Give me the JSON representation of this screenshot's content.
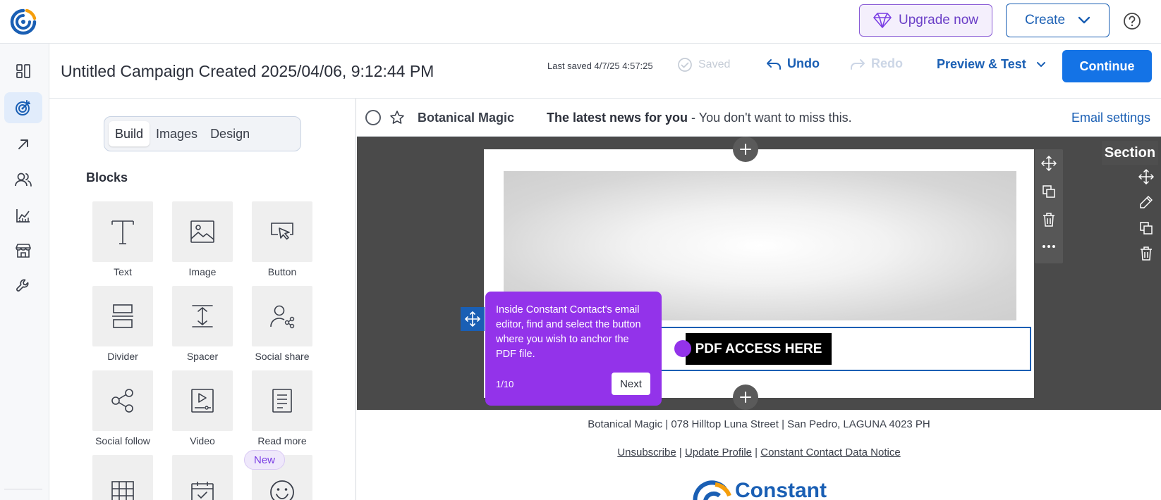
{
  "topbar": {
    "upgrade_label": "Upgrade now",
    "create_label": "Create"
  },
  "nav": {
    "items": [
      "dashboard-icon",
      "campaigns-icon",
      "outreach-icon",
      "contacts-icon",
      "reporting-icon",
      "store-icon",
      "tools-icon"
    ],
    "active": "campaigns-icon"
  },
  "header": {
    "campaign_title": "Untitled Campaign Created 2025/04/06, 9:12:44 PM",
    "last_saved": "Last saved 4/7/25 4:57:25",
    "saved_label": "Saved",
    "undo_label": "Undo",
    "redo_label": "Redo",
    "preview_label": "Preview & Test",
    "continue_label": "Continue"
  },
  "panel": {
    "tabs": [
      {
        "label": "Build",
        "active": true
      },
      {
        "label": "Images",
        "active": false
      },
      {
        "label": "Design",
        "active": false
      }
    ],
    "blocks_heading": "Blocks",
    "blocks": [
      {
        "label": "Text",
        "icon": "text-icon"
      },
      {
        "label": "Image",
        "icon": "image-icon"
      },
      {
        "label": "Button",
        "icon": "button-icon"
      },
      {
        "label": "Divider",
        "icon": "divider-icon"
      },
      {
        "label": "Spacer",
        "icon": "spacer-icon"
      },
      {
        "label": "Social share",
        "icon": "social-share-icon"
      },
      {
        "label": "Social follow",
        "icon": "social-follow-icon"
      },
      {
        "label": "Video",
        "icon": "video-icon"
      },
      {
        "label": "Read more",
        "icon": "read-more-icon"
      }
    ],
    "new_badge": "New"
  },
  "subject": {
    "sender": "Botanical Magic",
    "subject_bold": "The latest news for you",
    "subject_rest": " - You don't want to miss this.",
    "settings_label": "Email settings"
  },
  "canvas": {
    "pdf_button_label": "PDF ACCESS HERE",
    "section_label": "Section"
  },
  "tooltip": {
    "text": "Inside Constant Contact's email editor, find and select the button where you wish to anchor the PDF file.",
    "step": "1/10",
    "next_label": "Next"
  },
  "footer": {
    "address": "Botanical Magic | 078 Hilltop Luna Street | San Pedro, LAGUNA 4023 PH",
    "unsubscribe": "Unsubscribe",
    "update_profile": "Update Profile",
    "data_notice": "Constant Contact Data Notice",
    "separator": "|",
    "brand": "Constant"
  },
  "colors": {
    "primary": "#1a5fb4",
    "continue": "#1473e6",
    "upgrade": "#6b3fc7",
    "tooltip": "#9333ea",
    "canvas": "#4a4a4a"
  }
}
